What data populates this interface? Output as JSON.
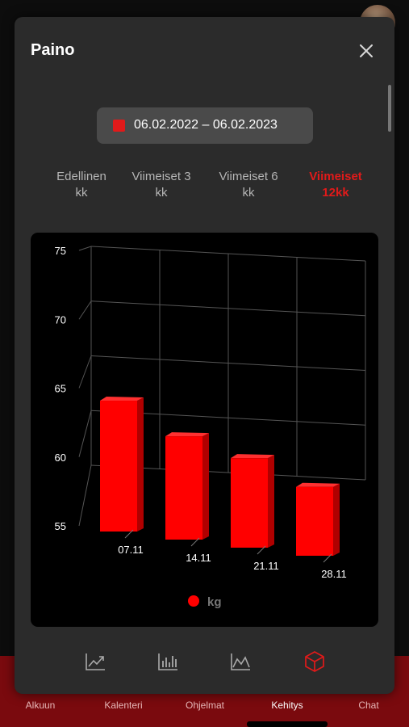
{
  "modal": {
    "title": "Paino",
    "date_range": "06.02.2022 – 06.02.2023",
    "period_tabs": [
      {
        "line1": "Edellinen",
        "line2": "kk",
        "active": false
      },
      {
        "line1": "Viimeiset 3",
        "line2": "kk",
        "active": false
      },
      {
        "line1": "Viimeiset 6",
        "line2": "kk",
        "active": false
      },
      {
        "line1": "Viimeiset",
        "line2": "12kk",
        "active": true
      }
    ],
    "toolbar_icons": [
      "line-chart-icon",
      "bar-chart-icon",
      "area-chart-icon",
      "cube-3d-icon"
    ],
    "active_toolbar_icon": "cube-3d-icon"
  },
  "chart_data": {
    "type": "bar",
    "categories": [
      "07.11",
      "14.11",
      "21.11",
      "28.11"
    ],
    "values": [
      64.5,
      62.5,
      61.5,
      60
    ],
    "ylim": [
      55,
      75
    ],
    "yticks": [
      55,
      60,
      65,
      70,
      75
    ],
    "legend": "kg",
    "legend_position": "bottom-center",
    "grid": true,
    "style": "3d",
    "bar_color": "#ff0000"
  },
  "bottom_nav": {
    "items": [
      "Alkuun",
      "Kalenteri",
      "Ohjelmat",
      "Kehitys",
      "Chat"
    ],
    "active": "Kehitys"
  },
  "colors": {
    "accent": "#e01a1a",
    "modal_bg": "#2b2b2b",
    "nav_bg": "#7a0a0e"
  }
}
